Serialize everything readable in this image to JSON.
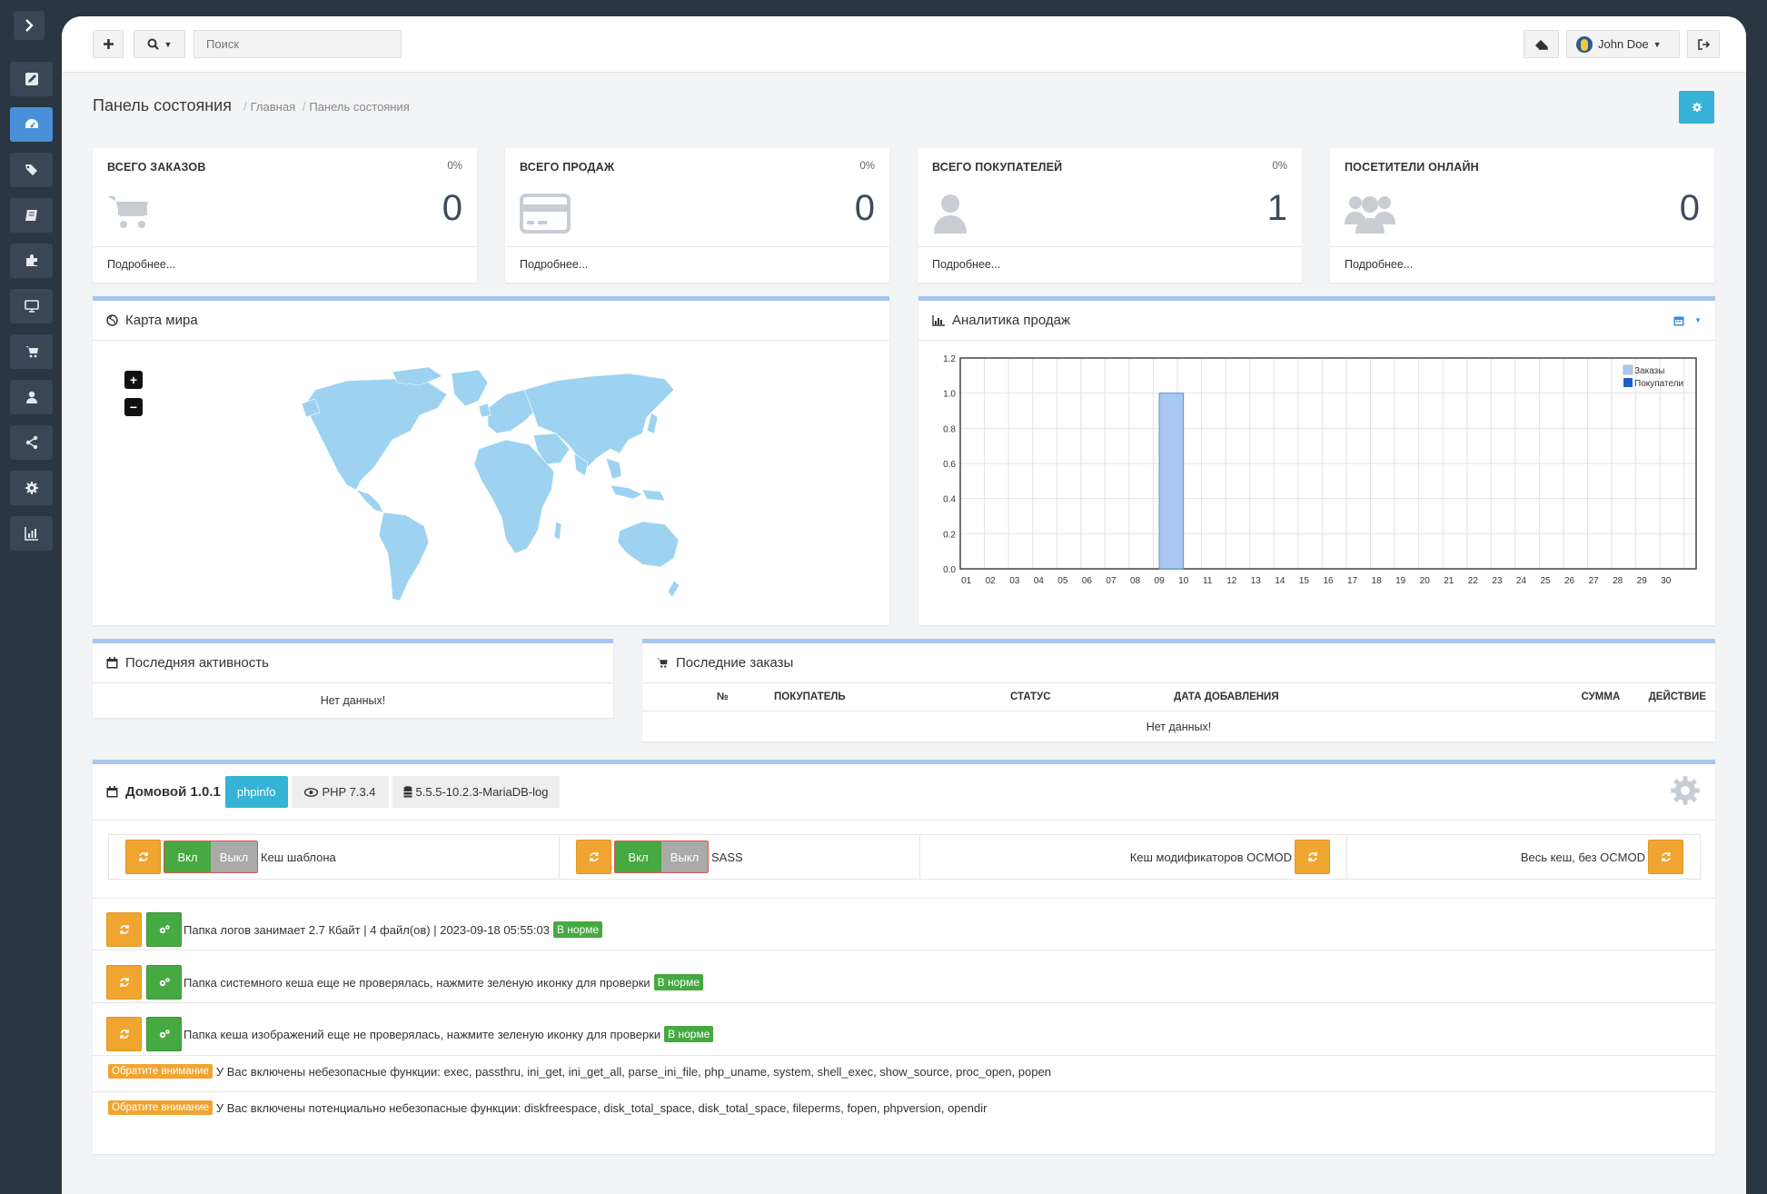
{
  "topbar": {
    "search_placeholder": "Поиск",
    "user_name": "John Doe"
  },
  "header": {
    "title": "Панель состояния",
    "breadcrumb": [
      "Главная",
      "Панель состояния"
    ]
  },
  "stats": [
    {
      "title": "ВСЕГО ЗАКАЗОВ",
      "pct": "0%",
      "value": "0",
      "more": "Подробнее...",
      "icon": "cart-icon"
    },
    {
      "title": "ВСЕГО ПРОДАЖ",
      "pct": "0%",
      "value": "0",
      "more": "Подробнее...",
      "icon": "credit-card-icon"
    },
    {
      "title": "ВСЕГО ПОКУПАТЕЛЕЙ",
      "pct": "0%",
      "value": "1",
      "more": "Подробнее...",
      "icon": "user-icon"
    },
    {
      "title": "ПОСЕТИТЕЛИ ОНЛАЙН",
      "pct": "",
      "value": "0",
      "more": "Подробнее...",
      "icon": "users-icon"
    }
  ],
  "world_map": {
    "title": "Карта мира",
    "zoom_in": "+",
    "zoom_out": "−"
  },
  "sales_analytics": {
    "title": "Аналитика продаж"
  },
  "chart_data": {
    "type": "bar",
    "categories": [
      "01",
      "02",
      "03",
      "04",
      "05",
      "06",
      "07",
      "08",
      "09",
      "10",
      "11",
      "12",
      "13",
      "14",
      "15",
      "16",
      "17",
      "18",
      "19",
      "20",
      "21",
      "22",
      "23",
      "24",
      "25",
      "26",
      "27",
      "28",
      "29",
      "30"
    ],
    "series": [
      {
        "name": "Заказы",
        "values": [
          0,
          0,
          0,
          0,
          0,
          0,
          0,
          0,
          1,
          0,
          0,
          0,
          0,
          0,
          0,
          0,
          0,
          0,
          0,
          0,
          0,
          0,
          0,
          0,
          0,
          0,
          0,
          0,
          0,
          0
        ]
      },
      {
        "name": "Покупатели",
        "values": [
          0,
          0,
          0,
          0,
          0,
          0,
          0,
          0,
          0,
          0,
          0,
          0,
          0,
          0,
          0,
          0,
          0,
          0,
          0,
          0,
          0,
          0,
          0,
          0,
          0,
          0,
          0,
          0,
          0,
          0
        ]
      }
    ],
    "yticks": [
      "0.0",
      "0.2",
      "0.4",
      "0.6",
      "0.8",
      "1.0",
      "1.2"
    ],
    "ylim": [
      0,
      1.2
    ],
    "legend": "top-right",
    "colors": {
      "orders": "#a8c8f0",
      "customers": "#1f5fc7"
    }
  },
  "activity": {
    "title": "Последняя активность",
    "empty": "Нет данных!"
  },
  "orders": {
    "title": "Последние заказы",
    "columns": [
      "№",
      "ПОКУПАТЕЛЬ",
      "СТАТУС",
      "ДАТА ДОБАВЛЕНИЯ",
      "СУММА",
      "ДЕЙСТВИЕ"
    ],
    "empty": "Нет данных!"
  },
  "domovoy": {
    "title": "Домовой 1.0.1",
    "phpinfo": "phpinfo",
    "php": "PHP 7.3.4",
    "db": "5.5.5-10.2.3-MariaDB-log",
    "on_label": "Вкл",
    "off_label": "Выкл",
    "cache_template": "Кеш шаблона",
    "sass": "SASS",
    "ocmod_cache": "Кеш модификаторов OCMOD",
    "all_cache": "Весь кеш, без OCMOD",
    "logs_line": "Папка логов занимает 2.7 Кбайт | 4 файл(ов) | 2023-09-18 05:55:03",
    "system_cache_line": "Папка системного кеша еще не проверялась, нажмите зеленую иконку для проверки",
    "image_cache_line": "Папка кеша изображений еще не проверялась, нажмите зеленую иконку для проверки",
    "ok_badge": "В норме",
    "attention_badge": "Обратите внимание",
    "unsafe_line": "У Вас включены небезопасные функции: exec, passthru, ini_get, ini_get_all, parse_ini_file, php_uname, system, shell_exec, show_source, proc_open, popen",
    "potentially_unsafe_line": "У Вас включены потенциально небезопасные функции: diskfreespace, disk_total_space, disk_total_space, fileperms, fopen, phpversion, opendir"
  }
}
